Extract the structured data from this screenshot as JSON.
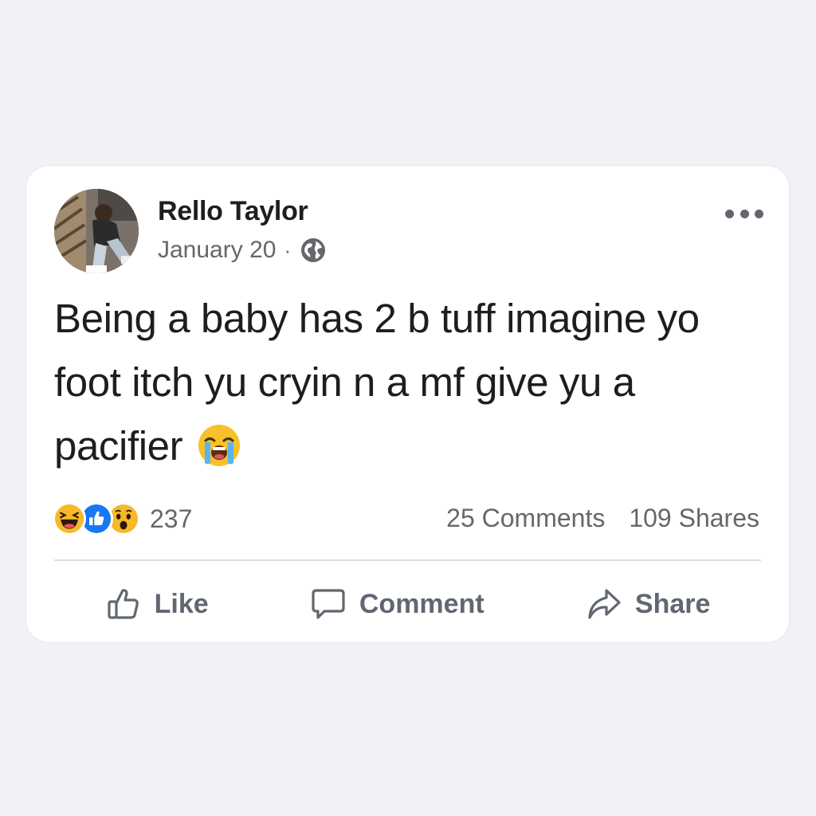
{
  "post": {
    "author": "Rello Taylor",
    "date": "January 20",
    "separator": "·",
    "privacy_icon": "globe-icon",
    "text": "Being a baby has 2 b tuff imagine yo foot itch yu cryin n a mf give yu a pacifier",
    "trailing_emoji": "loudly-crying-face"
  },
  "reactions": {
    "icons": [
      "haha-icon",
      "like-icon",
      "wow-icon"
    ],
    "count": "237"
  },
  "stats": {
    "comments": "25 Comments",
    "shares": "109 Shares"
  },
  "actions": {
    "like_label": "Like",
    "comment_label": "Comment",
    "share_label": "Share"
  },
  "colors": {
    "background": "#f0f2f5",
    "card": "#ffffff",
    "text_primary": "#1c1e21",
    "text_secondary": "#65676b",
    "like_blue": "#1877f2",
    "emoji_yellow": "#f7b928"
  }
}
